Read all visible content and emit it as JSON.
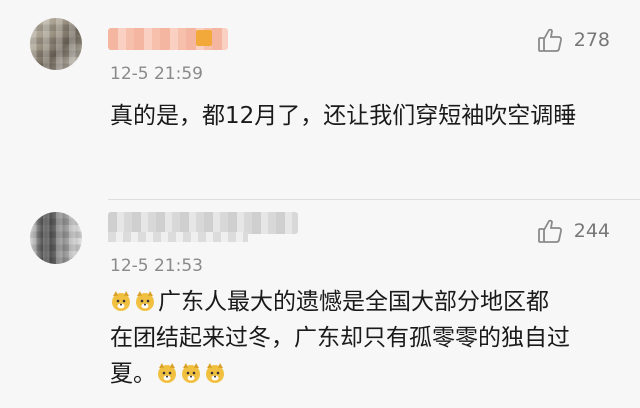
{
  "comments": [
    {
      "username_blurred": true,
      "time": "12-5 21:59",
      "likes": "278",
      "text": "真的是，都12月了，还让我们穿短袖吹空调睡"
    },
    {
      "username_blurred": true,
      "time": "12-5 21:53",
      "likes": "244",
      "text_line1": "广东人最大的遗憾是全国大部分地区都",
      "text_line2": "在团结起来过冬，广东却只有孤零零的独自过",
      "text_line3": "夏。",
      "emoji": "doge-icon"
    }
  ],
  "colors": {
    "background": "#f7f7f7",
    "meta_text": "#8a8a8a",
    "emoji_yellow": "#f2c040"
  }
}
